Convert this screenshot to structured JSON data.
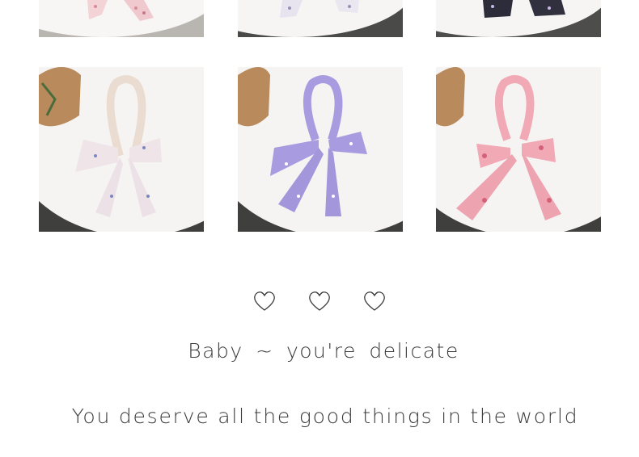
{
  "gallery": {
    "top_row": [
      {
        "name": "pink-floral-bow-photo-cropped"
      },
      {
        "name": "white-floral-bow-photo-cropped"
      },
      {
        "name": "black-floral-bow-photo-cropped"
      }
    ],
    "middle_row": [
      {
        "name": "beige-blue-floral-bow-headband"
      },
      {
        "name": "lavender-floral-bow-headband"
      },
      {
        "name": "pink-floral-bow-headband"
      }
    ]
  },
  "decoration": {
    "hearts": [
      "heart-outline-icon",
      "heart-outline-icon",
      "heart-outline-icon"
    ],
    "heart_color": "#3a3a3a"
  },
  "text": {
    "line1": "Baby ~  you're delicate",
    "line2": "You deserve all the good things in the world"
  },
  "colors": {
    "background": "#ffffff",
    "text": "#3a3a3a",
    "lavender": "#a99be0",
    "pink": "#f1a9b6"
  }
}
